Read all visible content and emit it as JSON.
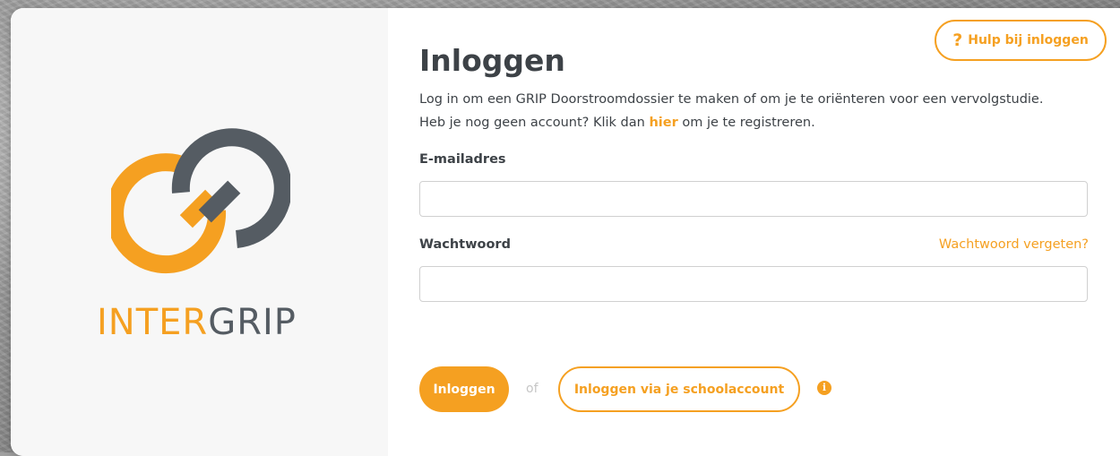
{
  "brand": {
    "name_highlight": "INTER",
    "name_rest": "GRIP",
    "colors": {
      "orange": "#f5a021",
      "grey": "#555c63"
    }
  },
  "help": {
    "icon": "question-mark-icon",
    "label": "Hulp bij inloggen"
  },
  "page": {
    "title": "Inloggen",
    "intro_before": "Log in om een GRIP Doorstroomdossier te maken of om je te oriënteren voor een vervolgstudie. Heb je nog geen account? Klik dan ",
    "intro_link": "hier",
    "intro_after": " om je te registreren."
  },
  "form": {
    "email_label": "E-mailadres",
    "email_value": "",
    "password_label": "Wachtwoord",
    "password_value": "",
    "forgot_label": "Wachtwoord vergeten?"
  },
  "actions": {
    "login_label": "Inloggen",
    "or_label": "of",
    "school_login_label": "Inloggen via je schoolaccount",
    "info_icon": "info-icon"
  }
}
